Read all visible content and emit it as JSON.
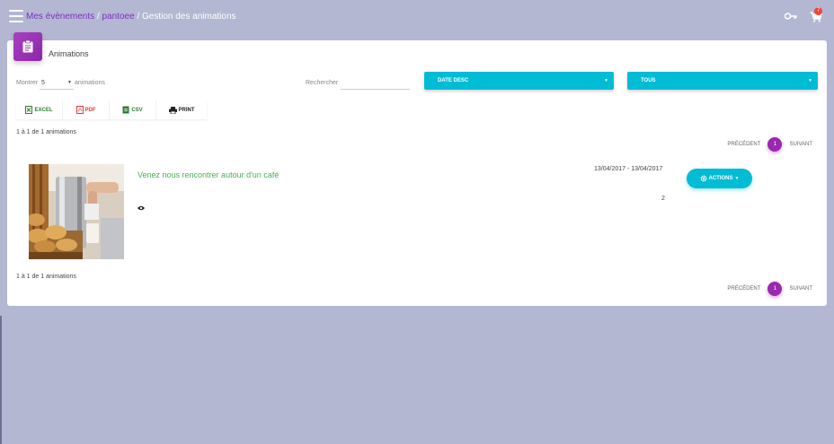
{
  "topbar": {
    "breadcrumb": [
      {
        "label": "Mes évènements"
      },
      {
        "label": "pantoee"
      },
      {
        "label": "Gestion des animations"
      }
    ],
    "separator": "/",
    "cart_count": "7"
  },
  "card": {
    "title": "Animations",
    "length": {
      "prefix": "Montrer",
      "value": "5",
      "suffix": "animations"
    },
    "search": {
      "label": "Rechercher",
      "value": ""
    },
    "sort_dropdown": "DATE DESC",
    "filter_dropdown": "TOUS",
    "export_buttons": [
      {
        "label": "EXCEL",
        "color": "#2e7d32"
      },
      {
        "label": "PDF",
        "color": "#e53935"
      },
      {
        "label": "CSV",
        "color": "#2e7d32"
      },
      {
        "label": "PRINT",
        "color": "#222222"
      }
    ],
    "info": "1 à 1 de 1 animations",
    "pagination": {
      "prev": "PRÉCÉDENT",
      "current": "1",
      "next": "SUIVANT"
    },
    "item": {
      "title": "Venez nous rencontrer autour d'un café",
      "dates": "13/04/2017 - 13/04/2017",
      "count": "2",
      "actions_label": "ACTIONS"
    }
  },
  "colors": {
    "accent_purple": "#9c27b0",
    "accent_cyan": "#00bcd4",
    "title_green": "#4caf50",
    "background": "#b3b7d2"
  }
}
